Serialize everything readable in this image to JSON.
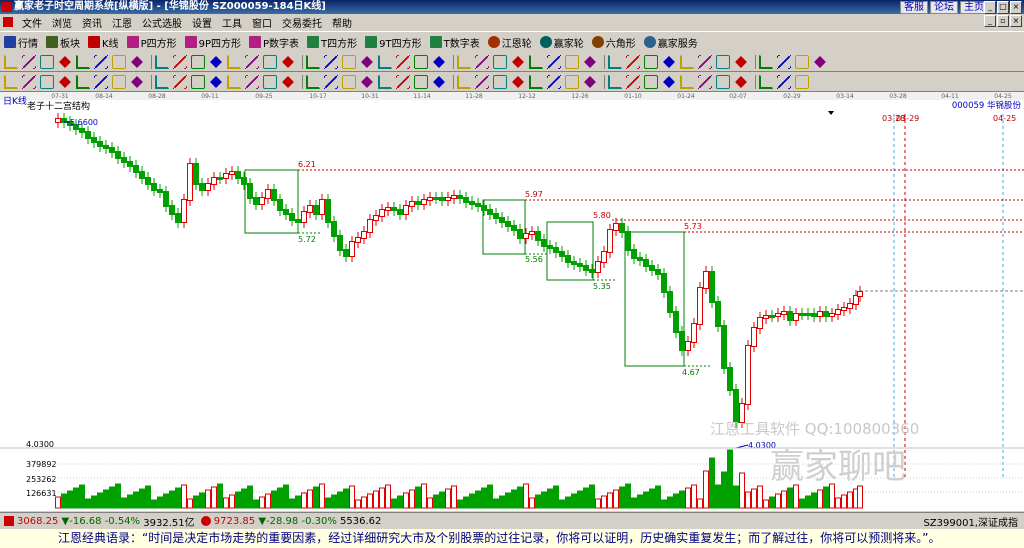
{
  "window": {
    "title": "赢家老子时空周期系统[纵横版] - [华锦股份  SZ000059-184日K线]",
    "links": [
      "客服",
      "论坛",
      "主页"
    ]
  },
  "menu": [
    "文件",
    "浏览",
    "资讯",
    "江恩",
    "公式选股",
    "设置",
    "工具",
    "窗口",
    "交易委托",
    "帮助"
  ],
  "toolbar": [
    {
      "label": "行情",
      "icon": "quote-icon"
    },
    {
      "label": "板块",
      "icon": "sector-icon"
    },
    {
      "label": "K线",
      "icon": "kline-icon"
    },
    {
      "label": "P四方形",
      "icon": "p-square-icon"
    },
    {
      "label": "9P四方形",
      "icon": "9p-square-icon"
    },
    {
      "label": "P数字表",
      "icon": "p-number-table-icon"
    },
    {
      "label": "T四方形",
      "icon": "t-square-icon"
    },
    {
      "label": "9T四方形",
      "icon": "9t-square-icon"
    },
    {
      "label": "T数字表",
      "icon": "t-number-table-icon"
    },
    {
      "label": "江恩轮",
      "icon": "gann-wheel-icon"
    },
    {
      "label": "赢家轮",
      "icon": "winner-wheel-icon"
    },
    {
      "label": "六角形",
      "icon": "hexagon-icon"
    },
    {
      "label": "赢家服务",
      "icon": "service-icon"
    }
  ],
  "colors": {
    "up": "#e00000",
    "down": "#00a000",
    "box": "#008000",
    "resist": "#c00000",
    "support": "#008000",
    "accent": "#0a246a"
  },
  "chart": {
    "period_label": "日K线",
    "indicator_label": "老子十二宫结构",
    "stock_label": "000059  华锦股份",
    "date_axis": [
      "07-31",
      "08-14",
      "08-28",
      "09-11",
      "09-25",
      "10-17",
      "10-31",
      "11-14",
      "11-28",
      "12-12",
      "12-26",
      "01-10",
      "01-24",
      "02-07",
      "02-29",
      "03-14",
      "03-28",
      "04-11",
      "04-25"
    ],
    "future_dates": [
      "03-28",
      "03-29",
      "04-25"
    ],
    "high_price": "5.6600",
    "low_price": "4.0300",
    "price_axis_low": "4.0300",
    "volume_ticks": [
      "379892",
      "253262",
      "126631"
    ],
    "levels": [
      {
        "label": "6.21",
        "type": "resist"
      },
      {
        "label": "5.72",
        "type": "support"
      },
      {
        "label": "5.97",
        "type": "resist"
      },
      {
        "label": "5.56",
        "type": "support"
      },
      {
        "label": "5.80",
        "type": "resist"
      },
      {
        "label": "5.35",
        "type": "support"
      },
      {
        "label": "5.73",
        "type": "resist"
      },
      {
        "label": "4.67",
        "type": "support"
      }
    ],
    "watermark_line1": "江恩工具软件  QQ:100800360",
    "watermark_line2": "赢家聊吧"
  },
  "statusbar": {
    "sh_index": "3068.25",
    "sh_change": "▼-16.68",
    "sh_pct": "-0.54%",
    "sh_amount": "3932.51亿",
    "sz_index": "9723.85",
    "sz_change": "▼-28.98",
    "sz_pct": "-0.30%",
    "sz_amount": "5536.62",
    "right_label": "SZ399001,深证成指"
  },
  "ticker": "江恩经典语录：“时间是决定市场走势的重要因素，经过详细研究大市及个别股票的过往记录，你将可以证明，历史确实重复发生；而了解过往，你将可以预测将来。”。"
}
